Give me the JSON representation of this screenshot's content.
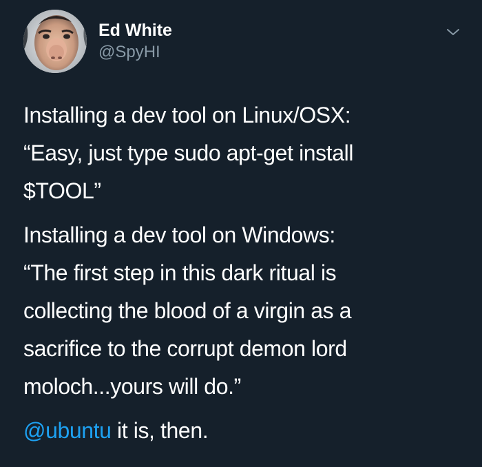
{
  "author": {
    "display_name": "Ed White",
    "handle": "@SpyHI"
  },
  "icons": {
    "avatar": "profile-photo",
    "menu": "chevron-down-icon"
  },
  "colors": {
    "background": "#15202b",
    "text": "#ffffff",
    "secondary_text": "#8899a6",
    "link": "#1da1f2"
  },
  "tweet": {
    "paragraph_1": {
      "line_1": "Installing a dev tool on Linux/OSX:",
      "line_2": "“Easy, just type sudo apt-get install",
      "line_3": "$TOOL”"
    },
    "paragraph_2": {
      "line_1": "Installing a dev tool on Windows:",
      "line_2": "“The first step in this dark ritual is",
      "line_3": "collecting the blood of a virgin as a",
      "line_4": "sacrifice to the corrupt demon lord",
      "line_5": "moloch...yours will do.”"
    },
    "paragraph_3": {
      "mention": "@ubuntu",
      "text": " it is, then."
    }
  }
}
